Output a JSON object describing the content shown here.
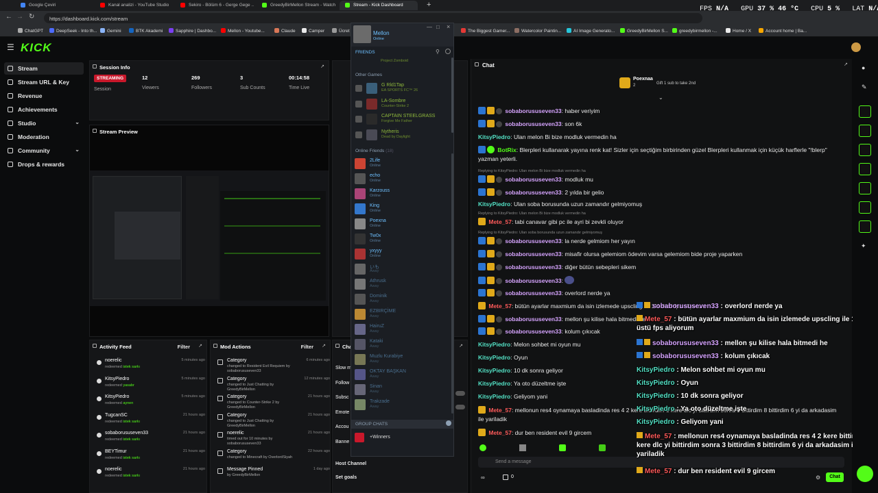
{
  "browser": {
    "tabs": [
      {
        "label": "Google Çeviri",
        "color": "#4285f4"
      },
      {
        "label": "Kanal analizi - YouTube Studio",
        "color": "#ff0000"
      },
      {
        "label": "Sekiro - Bölüm 6 - Gerge Gege ...",
        "color": "#ff0000"
      },
      {
        "label": "GreedyBirMellon Stream - Watch ...",
        "color": "#53fc18"
      },
      {
        "label": "Stream - Kick Dashboard",
        "color": "#53fc18"
      }
    ],
    "url": "https://dashboard.kick.com/stream",
    "bookmarks": [
      "ChatGPT",
      "DeepSeek - Into th...",
      "Gemini",
      "BTK Akademi",
      "Sapphire | Dashbo...",
      "Mellon - Youtube...",
      "Claude",
      "Camper",
      "Ücret",
      "The Biggest Gamer...",
      "Watercolor Paintin...",
      "AI Image Generato...",
      "GreedyBirMellon S...",
      "greedybirmellon -...",
      "Home / X",
      "Account home | Ba..."
    ]
  },
  "hud": {
    "fps_label": "FPS",
    "fps": "N/A",
    "gpu_label": "GPU",
    "gpu": "37 % 46 °C",
    "cpu_label": "CPU",
    "cpu": "5 %",
    "lat_label": "LAT",
    "lat": "N/A"
  },
  "kick": {
    "logo": "KICK",
    "nav": [
      {
        "label": "Stream"
      },
      {
        "label": "Stream URL & Key"
      },
      {
        "label": "Revenue"
      },
      {
        "label": "Achievements"
      },
      {
        "label": "Studio"
      },
      {
        "label": "Moderation"
      },
      {
        "label": "Community"
      },
      {
        "label": "Drops & rewards"
      }
    ],
    "session": {
      "title": "Session Info",
      "status": "STREAMING",
      "status_label": "Session",
      "viewers": "12",
      "viewers_label": "Viewers",
      "followers": "269",
      "followers_label": "Followers",
      "subs": "3",
      "subs_label": "Sub Counts",
      "time": "00:14:58",
      "time_label": "Time Live"
    },
    "preview_title": "Stream Preview",
    "activity": {
      "title": "Activity Feed",
      "filter": "Filter",
      "items": [
        {
          "user": "noerelic",
          "action": "redeemed",
          "target": "istek sarkı",
          "time": "5 minutes ago"
        },
        {
          "user": "KitsyPiedro",
          "action": "redeemed",
          "target": "yasabr",
          "time": "5 minutes ago"
        },
        {
          "user": "KitsyPiedro",
          "action": "redeemed",
          "target": "aynen",
          "time": "5 minutes ago"
        },
        {
          "user": "TugcanSC",
          "action": "redeemed",
          "target": "istek sarkı",
          "time": "21 hours ago"
        },
        {
          "user": "sobaborususeven33",
          "action": "redeemed",
          "target": "istek sarkı",
          "time": "21 hours ago"
        },
        {
          "user": "BEYTimur",
          "action": "redeemed",
          "target": "istek sarkı",
          "time": "21 hours ago"
        },
        {
          "user": "noerelic",
          "action": "redeemed",
          "target": "istek sarkı",
          "time": "21 hours ago"
        }
      ]
    },
    "mod": {
      "title": "Mod Actions",
      "filter": "Filter",
      "items": [
        {
          "title": "Category",
          "desc": "changed to Resident Evil Requiem by sobaborususeven33",
          "time": "6 minutes ago"
        },
        {
          "title": "Category",
          "desc": "changed to Just Chatting by GreedyBirMellon",
          "time": "12 minutes ago"
        },
        {
          "title": "Category",
          "desc": "changed to Counter-Strike 2 by GreedyBirMellon",
          "time": "21 hours ago"
        },
        {
          "title": "Category",
          "desc": "changed to Just Chatting by GreedyBirMellon",
          "time": "21 hours ago"
        },
        {
          "title": "noerelic",
          "desc": "timed out for 10 minutes by sobaborususeven33",
          "time": "21 hours ago"
        },
        {
          "title": "Category",
          "desc": "changed to Minecraft by OverlordSiyah",
          "time": "22 hours ago"
        },
        {
          "title": "Message Pinned",
          "desc": "by GreedyBirMellon",
          "time": "1 day ago"
        }
      ]
    },
    "chat_settings": {
      "title": "Cha",
      "rows": [
        "Slow m",
        "Follow",
        "Subsc",
        "Emote",
        "Accou",
        "Banne"
      ],
      "host": "Host Channel",
      "goals": "Set goals"
    }
  },
  "chat": {
    "title": "Chat",
    "pinned_user": "Poexnaa",
    "pinned_count": "2",
    "gift_text": "Gift 1 sub to take 2nd",
    "messages": [
      {
        "user": "sobaborususeven33",
        "color": "#d6a4ff",
        "text": "haber veriyim"
      },
      {
        "user": "sobaborususeven33",
        "color": "#d6a4ff",
        "text": "son 6k"
      },
      {
        "user": "KitsyPiedro",
        "color": "#53e0c4",
        "text": "Ulan melon Bi bize modluk vermedin ha"
      },
      {
        "user": "BotRix",
        "color": "#53fc18",
        "text": "Blerpleri kullanarak yayına renk kat! Sizler için seçtiğim birbirinden güzel Blerpleri kullanmak için küçük harflerle \"!blerp\" yazman yeterli."
      },
      {
        "user": "sobaborususeven33",
        "color": "#d6a4ff",
        "text": "modluk mu",
        "reply": "Replying to KitsyPiedro: Ulan melon Bi bize modluk vermedin ha"
      },
      {
        "user": "sobaborususeven33",
        "color": "#d6a4ff",
        "text": "2 yılda bir gelio"
      },
      {
        "user": "KitsyPiedro",
        "color": "#53e0c4",
        "text": "Ulan soba borusunda uzun zamandır gelmiyomuş"
      },
      {
        "user": "Mete_57",
        "color": "#ff5a5a",
        "text": "tabi canavar gibi pc ile ayri bi zevkli oluyor",
        "reply": "Replying to KitsyPiedro: Ulan melon Bi bize modluk vermedin ha"
      },
      {
        "user": "sobaborususeven33",
        "color": "#d6a4ff",
        "text": "la nerde gelmiom her yayın",
        "reply": "Replying to KitsyPiedro: Ulan soba borusunda uzun zamandır gelmiyomuş"
      },
      {
        "user": "sobaborususeven33",
        "color": "#d6a4ff",
        "text": "misafir olursa gelemiom ödevim varsa gelemiom bide proje yaparken"
      },
      {
        "user": "sobaborususeven33",
        "color": "#d6a4ff",
        "text": "diğer bütün sebepleri sikem"
      },
      {
        "user": "sobaborususeven33",
        "color": "#d6a4ff",
        "text": ""
      },
      {
        "user": "sobaborususeven33",
        "color": "#d6a4ff",
        "text": "overlord nerde ya"
      },
      {
        "user": "Mete_57",
        "color": "#ff5a5a",
        "text": "bütün ayarlar maxmium da isin izlemede upscling ile 111 üstü fps aliyorum"
      },
      {
        "user": "sobaborususeven33",
        "color": "#d6a4ff",
        "text": "mellon şu kilise hala bitmedi he"
      },
      {
        "user": "sobaborususeven33",
        "color": "#d6a4ff",
        "text": "kolum çıkıcak"
      },
      {
        "user": "KitsyPiedro",
        "color": "#53e0c4",
        "text": "Melon sohbet mi oyun mu"
      },
      {
        "user": "KitsyPiedro",
        "color": "#53e0c4",
        "text": "Oyun"
      },
      {
        "user": "KitsyPiedro",
        "color": "#53e0c4",
        "text": "10 dk sonra geliyor"
      },
      {
        "user": "KitsyPiedro",
        "color": "#53e0c4",
        "text": "Ya oto düzeltme işte"
      },
      {
        "user": "KitsyPiedro",
        "color": "#53e0c4",
        "text": "Geliyom yani"
      },
      {
        "user": "Mete_57",
        "color": "#ff5a5a",
        "text": "mellonun res4 oynamaya basladinda res 4 2 kere bittirdim 1 kere dlc yi bittirdim sonra 3 bittirdim 8 bittirdim 6 yi da arkadasim ile yariladik"
      },
      {
        "user": "Mete_57",
        "color": "#ff5a5a",
        "text": "dur ben resident evil 9 gircem"
      }
    ],
    "overlay": [
      {
        "user": "sobaborususeven33",
        "color": "#d6a4ff",
        "text": "overlord nerde ya"
      },
      {
        "user": "Mete_57",
        "color": "#ff5a5a",
        "text": "bütün ayarlar maxmium da isin izlemede upscling ile 111 üstü fps aliyorum"
      },
      {
        "user": "sobaborususeven33",
        "color": "#d6a4ff",
        "text": "mellon şu kilise hala bitmedi he"
      },
      {
        "user": "sobaborususeven33",
        "color": "#d6a4ff",
        "text": "kolum çıkıcak"
      },
      {
        "user": "KitsyPiedro",
        "color": "#53e0c4",
        "text": "Melon sohbet mi oyun mu"
      },
      {
        "user": "KitsyPiedro",
        "color": "#53e0c4",
        "text": "Oyun"
      },
      {
        "user": "KitsyPiedro",
        "color": "#53e0c4",
        "text": "10 dk sonra geliyor"
      },
      {
        "user": "KitsyPiedro",
        "color": "#53e0c4",
        "text": "Ya oto düzeltme işte"
      },
      {
        "user": "KitsyPiedro",
        "color": "#53e0c4",
        "text": "Geliyom yani"
      },
      {
        "user": "Mete_57",
        "color": "#ff5a5a",
        "text": "mellonun res4 oynamaya basladinda res 4 2 kere bittirdim 1 kere dlc yi bittirdim sonra 3 bittirdim 8 bittirdim 6 yi da arkadasim ile yariladik"
      },
      {
        "user": "Mete_57",
        "color": "#ff5a5a",
        "text": "dur ben resident evil 9 gircem"
      }
    ],
    "input_placeholder": "Send a message",
    "points": "0",
    "send": "Chat"
  },
  "steam": {
    "user": "Mellon",
    "status": "Online",
    "friends_label": "FRIENDS",
    "top_game": "Project Zomboid",
    "other_games_label": "Other Games",
    "game_friends": [
      {
        "name": "G Rld1Tap",
        "status": "EA SPORTS FC™ 26"
      },
      {
        "name": "LA-Sombre",
        "status": "Counter-Strike 2"
      },
      {
        "name": "CAPTAIN STEELGRASS",
        "status": "Forgive Me Father"
      },
      {
        "name": "Nytheris",
        "status": "Dead by Daylight"
      }
    ],
    "online_label": "Online Friends",
    "online_count": "(18)",
    "friends": [
      {
        "name": "2Life",
        "status": "Online",
        "away": false
      },
      {
        "name": "echo",
        "status": "Online",
        "away": false
      },
      {
        "name": "Karzouss",
        "status": "Online",
        "away": false
      },
      {
        "name": "King",
        "status": "Online",
        "away": false
      },
      {
        "name": "Poexna",
        "status": "Online",
        "away": false
      },
      {
        "name": "Tw0x",
        "status": "Online",
        "away": false
      },
      {
        "name": "yxyyy",
        "status": "Online",
        "away": false
      },
      {
        "name": "いも",
        "status": "Away",
        "away": true
      },
      {
        "name": "Athrusk",
        "status": "Away",
        "away": true
      },
      {
        "name": "Dominik",
        "status": "Away",
        "away": true
      },
      {
        "name": "EZBIRÇİME",
        "status": "Away",
        "away": true
      },
      {
        "name": "HairuZ",
        "status": "Away",
        "away": true
      },
      {
        "name": "Kataki",
        "status": "Away",
        "away": true
      },
      {
        "name": "Muzlu Kurabiye",
        "status": "Away",
        "away": true
      },
      {
        "name": "OKTAY BAŞKAN",
        "status": "Away",
        "away": true
      },
      {
        "name": "Sinan",
        "status": "Away",
        "away": true
      },
      {
        "name": "Trakzade",
        "status": "Away",
        "away": true
      }
    ],
    "group_label": "GROUP CHATS",
    "group": "+Winners"
  },
  "colors": {
    "accent": "#53fc18",
    "live": "#c9182b"
  }
}
